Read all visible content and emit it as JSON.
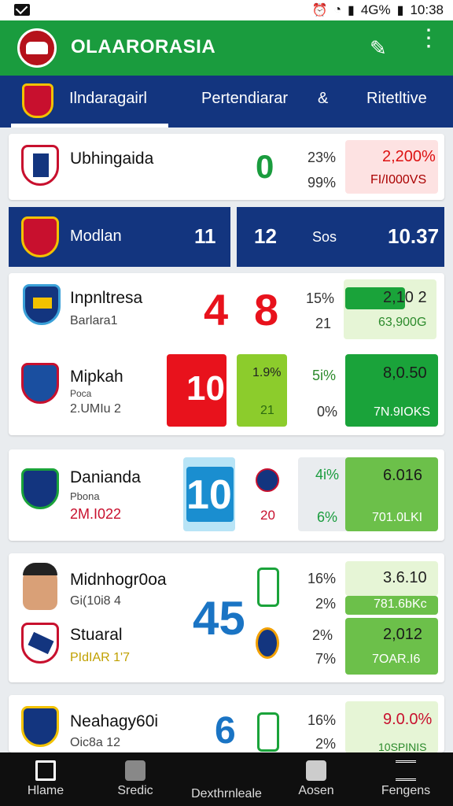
{
  "status_bar": {
    "signal_text": "4G%",
    "time": "10:38"
  },
  "app_bar": {
    "title": "OLAARORASIA"
  },
  "tabs": [
    {
      "label": "Ilndaragairl"
    },
    {
      "label": "Pertendiarar"
    },
    {
      "label": "&"
    },
    {
      "label": "Ritetltive"
    }
  ],
  "card1": {
    "team": "Ubhingaida",
    "score": "0",
    "pct_top": "23%",
    "pct_bottom": "99%",
    "box_top": "2,200%",
    "box_bottom": "FI/I000VS"
  },
  "blue_row": {
    "team": "Modlan",
    "score_a": "11",
    "score_b": "12",
    "label": "Sos",
    "value": "10.37"
  },
  "card2": {
    "team1": "Inpnltresa",
    "team1_sub": "Barlara1",
    "score_a": "4",
    "score_b": "8",
    "pct1_top": "15%",
    "pct1_bottom": "21",
    "box1_top": "2,10 2",
    "box1_bottom": "63,900G",
    "team2": "Mipkah",
    "team2_sub1": "Poca",
    "team2_sub2": "2.UMIu 2",
    "score_red": "10",
    "lime_top": "1.9%",
    "lime_bottom": "21",
    "pct2_top": "5i%",
    "pct2_bottom": "0%",
    "box2_top": "8,0.50",
    "box2_bottom": "7N.9IOKS"
  },
  "card3": {
    "team": "Danianda",
    "sub1": "Pbona",
    "sub2": "2M.I022",
    "score": "10",
    "small": "20",
    "pct_top": "4i%",
    "pct_bottom": "6%",
    "box_top": "6.016",
    "box_bottom": "701.0LKI"
  },
  "card4": {
    "team1": "Midnhogr0oa",
    "team1_sub": "Gi(10i8 4",
    "score": "45",
    "pct1_top": "16%",
    "pct1_bottom": "2%",
    "box1_top": "3.6.10",
    "box1_bottom": "781.6bKc",
    "team2": "Stuaral",
    "team2_sub": "PIdIAR 1'7",
    "pct2_top": "2%",
    "pct2_bottom": "7%",
    "box2_top": "2,012",
    "box2_bottom": "7OAR.I6"
  },
  "card5": {
    "team": "Neahagy60i",
    "sub": "Oic8a 12",
    "score": "6",
    "pct_top": "16%",
    "pct_bottom": "2%",
    "box_top": "9.0.0%",
    "box_bottom": "10SPINIS"
  },
  "bottom_nav": [
    {
      "label": "Hlame",
      "icon": "home-icon"
    },
    {
      "label": "Sredic",
      "icon": "phone-icon"
    },
    {
      "label": "Dexthrnleale",
      "icon": ""
    },
    {
      "label": "Aosen",
      "icon": "badge-icon"
    },
    {
      "label": "Fengens",
      "icon": "menu-icon"
    }
  ],
  "colors": {
    "green": "#1a9c3e",
    "blue": "#13357f",
    "red": "#e8121c",
    "lime": "#8ccc2c"
  }
}
